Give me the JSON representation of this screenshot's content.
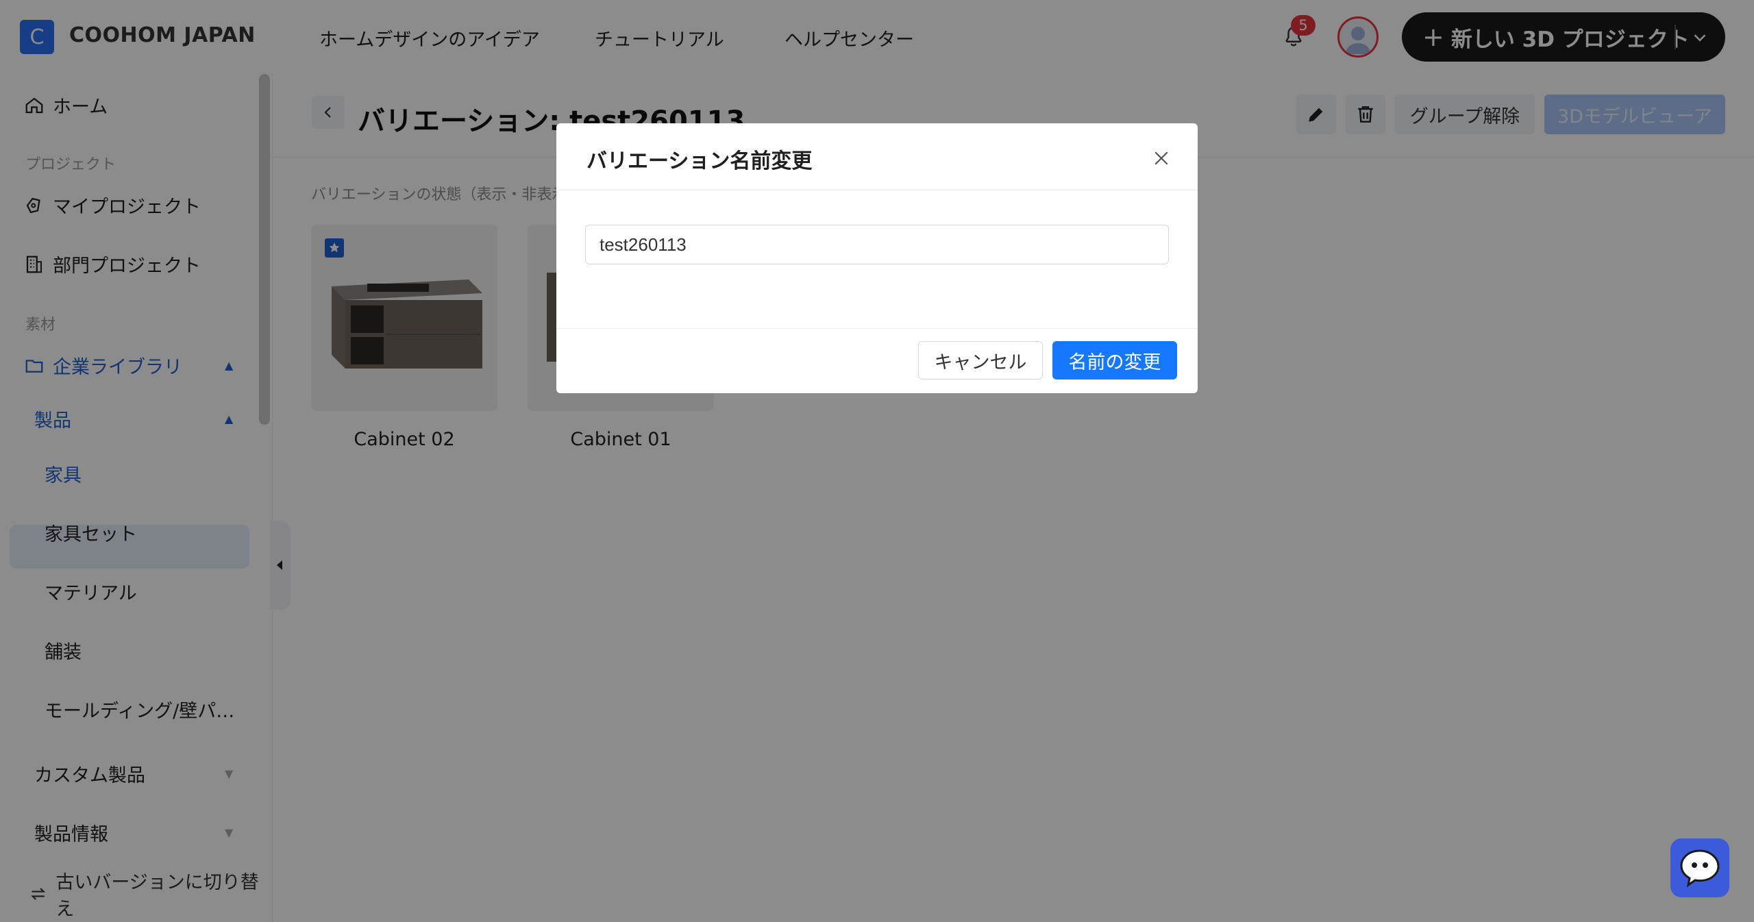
{
  "header": {
    "logo_letter": "C",
    "brand": "COOHOM JAPAN",
    "nav": [
      "ホームデザインのアイデア",
      "チュートリアル",
      "ヘルプセンター"
    ],
    "notification_count": "5",
    "new_project_label": "新しい 3D プロジェクト"
  },
  "sidebar": {
    "home": "ホーム",
    "section_projects": "プロジェクト",
    "my_projects": "マイプロジェクト",
    "dept_projects": "部門プロジェクト",
    "section_materials": "素材",
    "enterprise_library": "企業ライブラリ",
    "products": "製品",
    "furniture": "家具",
    "furniture_set": "家具セット",
    "material": "マテリアル",
    "pavement": "舗装",
    "molding": "モールディング/壁パ…",
    "custom_products": "カスタム製品",
    "product_info": "製品情報",
    "switch_old": "古いバージョンに切り替え"
  },
  "main": {
    "title": "バリエーション: test260113",
    "ungroup_label": "グループ解除",
    "viewer_label": "3Dモデルビューア",
    "state_text": "バリエーションの状態（表示・非表示",
    "cards": [
      {
        "label": "Cabinet 02"
      },
      {
        "label": "Cabinet 01"
      }
    ]
  },
  "modal": {
    "title": "バリエーション名前変更",
    "input_value": "test260113",
    "cancel_label": "キャンセル",
    "confirm_label": "名前の変更"
  },
  "colors": {
    "accent": "#1677ff",
    "brand": "#2a6ff5",
    "badge": "#e8343c"
  },
  "icons": [
    "home-icon",
    "projects-icon",
    "building-icon",
    "folder-icon",
    "bell-icon",
    "avatar-icon",
    "plus-icon",
    "chevron-down-icon",
    "back-icon",
    "edit-icon",
    "trash-icon",
    "close-icon",
    "chat-icon",
    "switch-icon",
    "star-icon"
  ]
}
